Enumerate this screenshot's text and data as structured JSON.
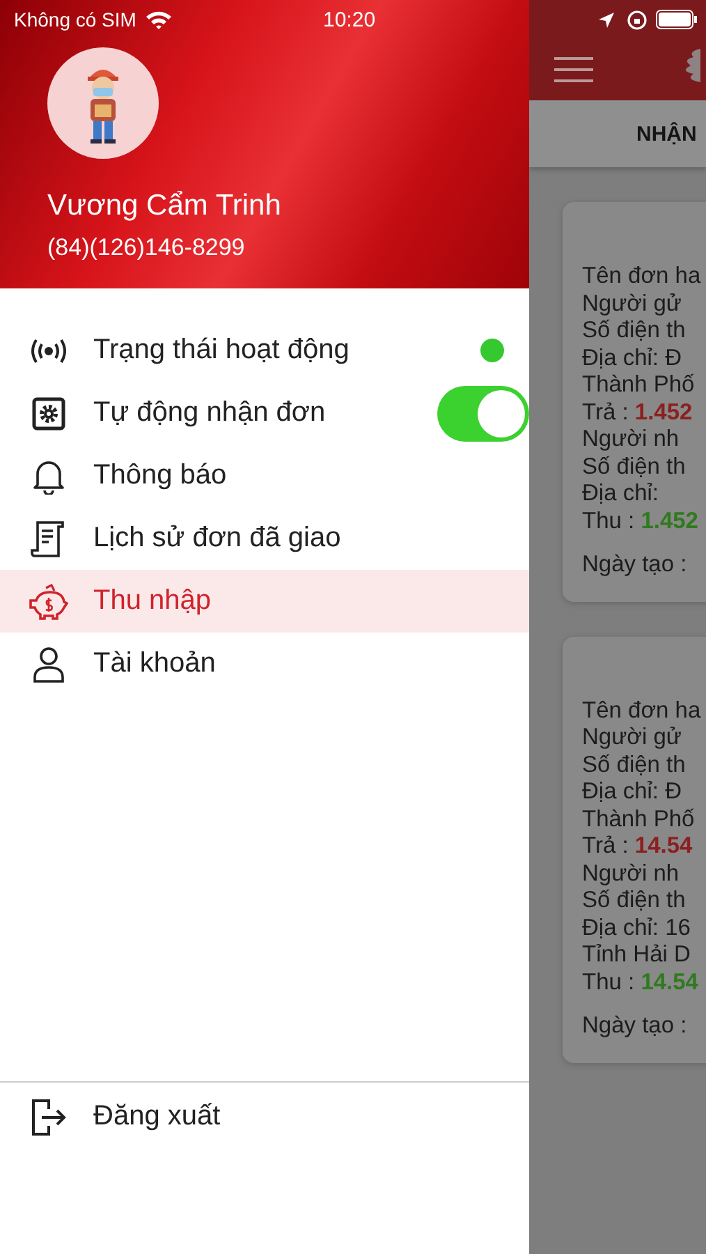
{
  "status_bar": {
    "carrier": "Không có SIM",
    "time": "10:20"
  },
  "profile": {
    "name": "Vương Cẩm Trinh",
    "phone": "(84)(126)146-8299"
  },
  "menu_items": [
    {
      "label": "Trạng thái hoạt động",
      "kind": "status",
      "color": "#35c92f",
      "selected": false
    },
    {
      "label": "Tự động nhận đơn",
      "kind": "toggle",
      "on": true,
      "selected": false
    },
    {
      "label": "Thông báo",
      "kind": "plain",
      "selected": false
    },
    {
      "label": "Lịch sử đơn đã giao",
      "kind": "plain",
      "selected": false
    },
    {
      "label": "Thu nhập",
      "kind": "plain",
      "selected": true
    },
    {
      "label": "Tài khoản",
      "kind": "plain",
      "selected": false
    }
  ],
  "logout": {
    "label": "Đăng xuất"
  },
  "background_screen": {
    "tab": "NHẬN",
    "cards": [
      {
        "lines": [
          {
            "text": "Tên đơn ha"
          },
          {
            "text": "Người gử"
          },
          {
            "text": "Số điện th"
          },
          {
            "text": "Địa chỉ: Đ"
          },
          {
            "text": "Thành Phố"
          },
          {
            "text": "Trả : ",
            "amount": "1.452",
            "kind": "charge"
          },
          {
            "text": "Người nh"
          },
          {
            "text": "Số điện th"
          },
          {
            "text": "Địa chỉ:"
          },
          {
            "text": "Thu : ",
            "amount": "1.452",
            "kind": "collect"
          }
        ],
        "footer": "Ngày tạo :"
      },
      {
        "lines": [
          {
            "text": "Tên đơn ha"
          },
          {
            "text": "Người gử"
          },
          {
            "text": "Số điện th"
          },
          {
            "text": "Địa chỉ: Đ"
          },
          {
            "text": "Thành Phố"
          },
          {
            "text": "Trả : ",
            "amount": "14.54",
            "kind": "charge"
          },
          {
            "text": "Người nh"
          },
          {
            "text": "Số điện th"
          },
          {
            "text": "Địa chỉ: 16"
          },
          {
            "text": "Tỉnh Hải D"
          },
          {
            "text": "Thu : ",
            "amount": "14.54",
            "kind": "collect"
          }
        ],
        "footer": "Ngày tạo :"
      }
    ]
  }
}
